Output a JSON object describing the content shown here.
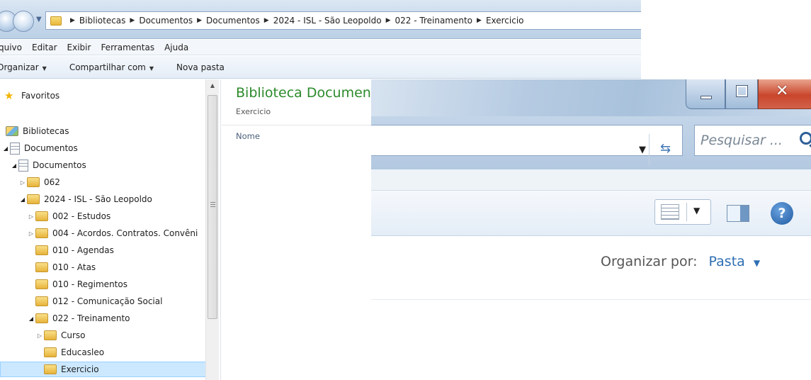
{
  "breadcrumb": [
    "Bibliotecas",
    "Documentos",
    "Documentos",
    "2024 - ISL - São Leopoldo",
    "022 - Treinamento",
    "Exercicio"
  ],
  "menu": [
    "quivo",
    "Editar",
    "Exibir",
    "Ferramentas",
    "Ajuda"
  ],
  "toolbar": {
    "organizar": "Organizar",
    "compartilhar": "Compartilhar com",
    "nova_pasta": "Nova pasta"
  },
  "tree": [
    {
      "label": "Favoritos",
      "icon": "star-icon",
      "expander": ""
    },
    {
      "label": "Bibliotecas",
      "icon": "library-icon",
      "expander": ""
    },
    {
      "label": "Documentos",
      "icon": "document-icon",
      "expander": "open"
    },
    {
      "label": "Documentos",
      "icon": "document-icon",
      "expander": "open"
    },
    {
      "label": "062",
      "icon": "folder-icon",
      "expander": "closed"
    },
    {
      "label": "2024 - ISL - São Leopoldo",
      "icon": "folder-icon",
      "expander": "open"
    },
    {
      "label": "002 - Estudos",
      "icon": "folder-icon",
      "expander": "closed"
    },
    {
      "label": "004 - Acordos. Contratos. Convêni",
      "icon": "folder-icon",
      "expander": "closed"
    },
    {
      "label": "010 - Agendas",
      "icon": "folder-icon",
      "expander": ""
    },
    {
      "label": "010 - Atas",
      "icon": "folder-icon",
      "expander": ""
    },
    {
      "label": "010 - Regimentos",
      "icon": "folder-icon",
      "expander": ""
    },
    {
      "label": "012 - Comunicação Social",
      "icon": "folder-icon",
      "expander": ""
    },
    {
      "label": "022 - Treinamento",
      "icon": "folder-icon",
      "expander": "open"
    },
    {
      "label": "Curso",
      "icon": "folder-icon",
      "expander": "closed"
    },
    {
      "label": "Educasleo",
      "icon": "folder-icon",
      "expander": ""
    },
    {
      "label": "Exercicio",
      "icon": "folder-icon",
      "expander": "",
      "selected": true
    }
  ],
  "content": {
    "title": "Biblioteca Documen",
    "subtitle": "Exercicio",
    "column_name": "Nome"
  },
  "zoom": {
    "search_placeholder": "Pesquisar ...",
    "organizar_label": "Organizar por:",
    "organizar_value": "Pasta"
  },
  "colors": {
    "accent_green": "#2b8a2b",
    "link_blue": "#2f6fb3",
    "selection": "#cce8ff"
  }
}
